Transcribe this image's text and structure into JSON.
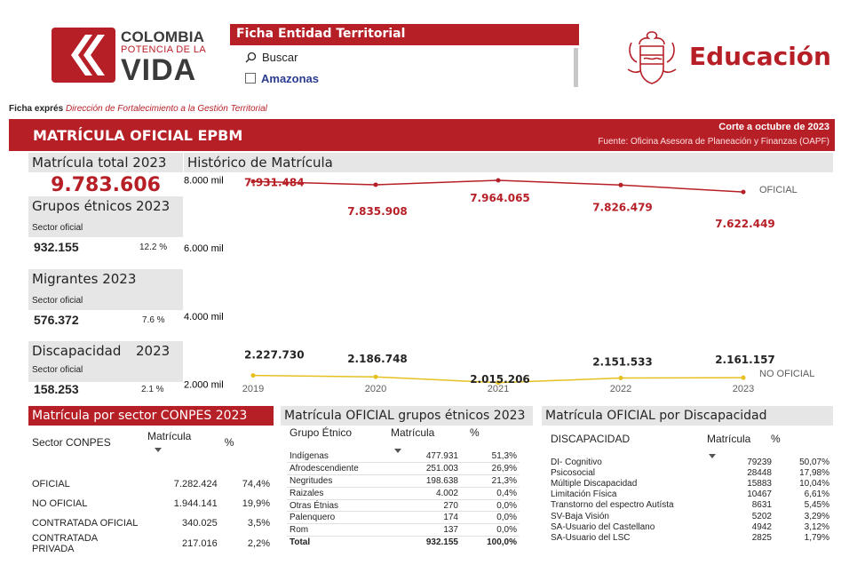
{
  "header": {
    "logo_line1": "COLOMBIA",
    "logo_line2": "POTENCIA DE LA",
    "logo_line3": "VIDA",
    "slicer_title": "Ficha Entidad Territorial",
    "search_placeholder": "Buscar",
    "slicer_item": "Amazonas",
    "brand": "Educación"
  },
  "ficha": {
    "bold": "Ficha exprés",
    "italic": "Dirección de Fortalecimiento a la Gestión Territorial"
  },
  "band": {
    "title": "MATRÍCULA OFICIAL EPBM",
    "corte": "Corte a octubre de 2023",
    "fuente": "Fuente: Oficina Asesora de Planeación y Finanzas (OAPF)"
  },
  "kpis": {
    "total_label": "Matrícula total 2023",
    "total_value": "9.783.606",
    "etnicos_label": "Grupos étnicos",
    "etnicos_year": "2023",
    "etnicos_sub": "Sector oficial",
    "etnicos_value": "932.155",
    "etnicos_pct": "12.2 %",
    "migrantes_label": "Migrantes 2023",
    "migrantes_sub": "Sector oficial",
    "migrantes_value": "576.372",
    "migrantes_pct": "7.6 %",
    "disc_label": "Discapacidad",
    "disc_year": "2023",
    "disc_sub": "Sector oficial",
    "disc_value": "158.253",
    "disc_pct": "2.1 %"
  },
  "chart_data": {
    "type": "line",
    "title": "Histórico de Matrícula",
    "x": [
      "2019",
      "2020",
      "2021",
      "2022",
      "2023"
    ],
    "ytick_labels": [
      "8.000 mil",
      "6.000 mil",
      "4.000 mil",
      "2.000 mil"
    ],
    "ylim": [
      1800000,
      8200000
    ],
    "series": [
      {
        "name": "OFICIAL",
        "color": "#b71f27",
        "values": [
          7931484,
          7835908,
          7964065,
          7826479,
          7622449
        ],
        "labels": [
          "7.931.484",
          "7.835.908",
          "7.964.065",
          "7.826.479",
          "7.622.449"
        ]
      },
      {
        "name": "NO OFICIAL",
        "color": "#e6c020",
        "values": [
          2227730,
          2186748,
          2015206,
          2151533,
          2161157
        ],
        "labels": [
          "2.227.730",
          "2.186.748",
          "2.015.206",
          "2.151.533",
          "2.161.157"
        ]
      }
    ]
  },
  "conpes": {
    "title": "Matrícula por sector CONPES 2023",
    "headers": [
      "Sector CONPES",
      "Matrícula",
      "%"
    ],
    "rows": [
      [
        "OFICIAL",
        "7.282.424",
        "74,4%"
      ],
      [
        "NO OFICIAL",
        "1.944.141",
        "19,9%"
      ],
      [
        "CONTRATADA OFICIAL",
        "340.025",
        "3,5%"
      ],
      [
        "CONTRATADA PRIVADA",
        "217.016",
        "2,2%"
      ]
    ]
  },
  "etnicos": {
    "title": "Matrícula OFICIAL grupos étnicos 2023",
    "headers": [
      "Grupo Étnico",
      "Matrícula",
      "%"
    ],
    "rows": [
      [
        "Indígenas",
        "477.931",
        "51,3%"
      ],
      [
        "Afrodescendiente",
        "251.003",
        "26,9%"
      ],
      [
        "Negritudes",
        "198.638",
        "21,3%"
      ],
      [
        "Raizales",
        "4.002",
        "0,4%"
      ],
      [
        "Otras Étnias",
        "270",
        "0,0%"
      ],
      [
        "Palenquero",
        "174",
        "0,0%"
      ],
      [
        "Rom",
        "137",
        "0,0%"
      ]
    ],
    "total": [
      "Total",
      "932.155",
      "100,0%"
    ]
  },
  "discapacidad": {
    "title": "Matrícula OFICIAL por Discapacidad",
    "headers": [
      "DISCAPACIDAD",
      "Matrícula",
      "%"
    ],
    "rows": [
      [
        "DI- Cognitivo",
        "79239",
        "50,07%"
      ],
      [
        "Psicosocial",
        "28448",
        "17,98%"
      ],
      [
        "Múltiple Discapacidad",
        "15883",
        "10,04%"
      ],
      [
        "Limitación Física",
        "10467",
        "6,61%"
      ],
      [
        "Transtorno del espectro Autísta",
        "8631",
        "5,45%"
      ],
      [
        "SV-Baja Visión",
        "5202",
        "3,29%"
      ],
      [
        "SA-Usuario del Castellano",
        "4942",
        "3,12%"
      ],
      [
        "SA-Usuario del LSC",
        "2825",
        "1,79%"
      ]
    ]
  }
}
